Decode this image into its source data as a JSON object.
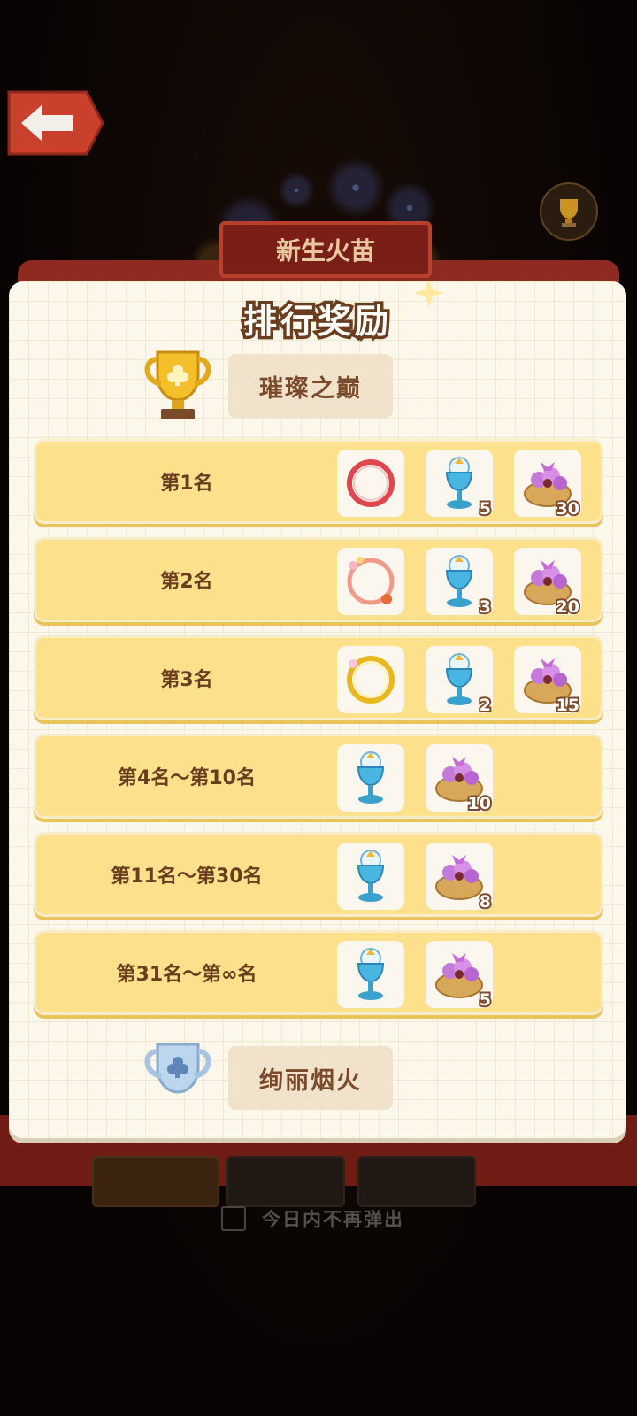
{
  "header": {
    "event_title": "新生火苗"
  },
  "panel": {
    "title": "排行奖励",
    "sections": [
      {
        "label": "璀璨之巅",
        "cup": "gold-trophy"
      },
      {
        "label": "绚丽烟火",
        "cup": "silver-trophy"
      }
    ],
    "rows": [
      {
        "rank": "第1名",
        "rewards": [
          {
            "icon": "red-ring-icon"
          },
          {
            "icon": "blue-goblet-icon",
            "count": "5"
          },
          {
            "icon": "flower-basket-icon",
            "count": "30"
          }
        ]
      },
      {
        "rank": "第2名",
        "rewards": [
          {
            "icon": "floral-ring-icon"
          },
          {
            "icon": "blue-goblet-icon",
            "count": "3"
          },
          {
            "icon": "flower-basket-icon",
            "count": "20"
          }
        ]
      },
      {
        "rank": "第3名",
        "rewards": [
          {
            "icon": "gold-ring-icon"
          },
          {
            "icon": "blue-goblet-icon",
            "count": "2"
          },
          {
            "icon": "flower-basket-icon",
            "count": "15"
          }
        ]
      },
      {
        "rank": "第4名～第10名",
        "rewards": [
          {
            "icon": "blue-goblet-icon"
          },
          {
            "icon": "flower-basket-icon",
            "count": "10"
          }
        ]
      },
      {
        "rank": "第11名～第30名",
        "rewards": [
          {
            "icon": "blue-goblet-icon"
          },
          {
            "icon": "flower-basket-icon",
            "count": "8"
          }
        ]
      },
      {
        "rank": "第31名～第∞名",
        "rewards": [
          {
            "icon": "blue-goblet-icon"
          },
          {
            "icon": "flower-basket-icon",
            "count": "5"
          }
        ]
      }
    ]
  },
  "footer": {
    "no_popup_label": "今日内不再弹出"
  }
}
